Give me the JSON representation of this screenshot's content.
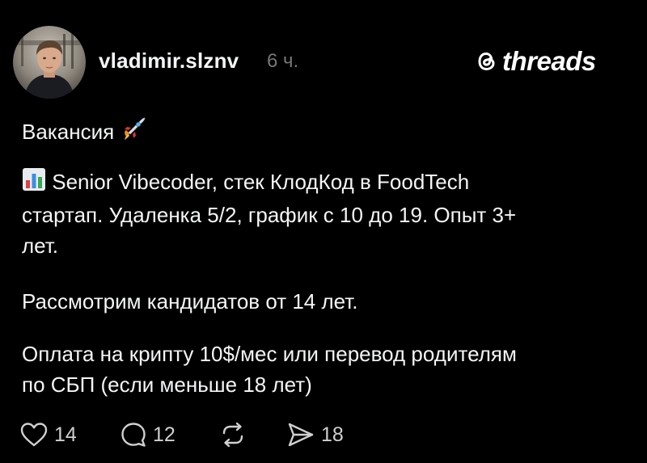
{
  "post": {
    "author": {
      "username": "vladimir.slznv",
      "timestamp": "6 ч."
    },
    "brand": {
      "name": "threads",
      "icon": "threads-logo-icon"
    },
    "body": {
      "heading": "Вакансия",
      "heading_emoji_icon": "rocket-icon",
      "paragraph1_icon": "bar-chart-icon",
      "paragraph1_line1": "Senior Vibecoder, стек КлодКод в FoodTech",
      "paragraph1_line2": "стартап. Удаленка 5/2, график с 10 до 19. Опыт 3+",
      "paragraph1_line3": "лет.",
      "paragraph2": "Рассмотрим кандидатов от 14 лет.",
      "paragraph3_line1": "Оплата на крипту 10$/мес или перевод родителям",
      "paragraph3_line2": "по СБП (если меньше 18 лет)"
    },
    "actions": {
      "likes": "14",
      "replies": "12",
      "reposts": "",
      "shares": "18"
    }
  }
}
